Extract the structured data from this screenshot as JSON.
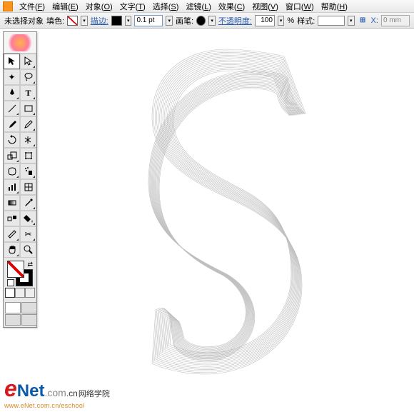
{
  "menubar": {
    "items": [
      {
        "label": "文件",
        "key": "F"
      },
      {
        "label": "编辑",
        "key": "E"
      },
      {
        "label": "对象",
        "key": "O"
      },
      {
        "label": "文字",
        "key": "T"
      },
      {
        "label": "选择",
        "key": "S"
      },
      {
        "label": "滤镜",
        "key": "L"
      },
      {
        "label": "效果",
        "key": "C"
      },
      {
        "label": "视图",
        "key": "V"
      },
      {
        "label": "窗口",
        "key": "W"
      },
      {
        "label": "帮助",
        "key": "H"
      }
    ]
  },
  "optbar": {
    "selection_status": "未选择对象",
    "fill_label": "填色:",
    "stroke_label": "描边:",
    "stroke_weight": "0.1 pt",
    "brush_label": "画笔:",
    "opacity_label": "不透明度:",
    "opacity_value": "100",
    "opacity_unit": "%",
    "style_label": "样式:",
    "x_label": "X:",
    "x_value": "0 mm"
  },
  "tools": [
    [
      "selection-tool",
      "direct-selection-tool"
    ],
    [
      "magic-wand-tool",
      "lasso-tool"
    ],
    [
      "pen-tool",
      "type-tool"
    ],
    [
      "line-tool",
      "rectangle-tool"
    ],
    [
      "paintbrush-tool",
      "pencil-tool"
    ],
    [
      "rotate-tool",
      "reflect-tool"
    ],
    [
      "scale-tool",
      "free-transform-tool"
    ],
    [
      "warp-tool",
      "symbol-sprayer-tool"
    ],
    [
      "column-graph-tool",
      "mesh-tool"
    ],
    [
      "gradient-tool",
      "eyedropper-tool"
    ],
    [
      "blend-tool",
      "live-paint-bucket-tool"
    ],
    [
      "slice-tool",
      "scissors-tool"
    ],
    [
      "hand-tool",
      "zoom-tool"
    ]
  ],
  "watermark": {
    "main_e": "e",
    "main_net": "Net",
    "main_com": ".com",
    "main_cn": "网络学院",
    "cn2": ".cn",
    "sub": "www.eNet.com.cn/eschool"
  }
}
